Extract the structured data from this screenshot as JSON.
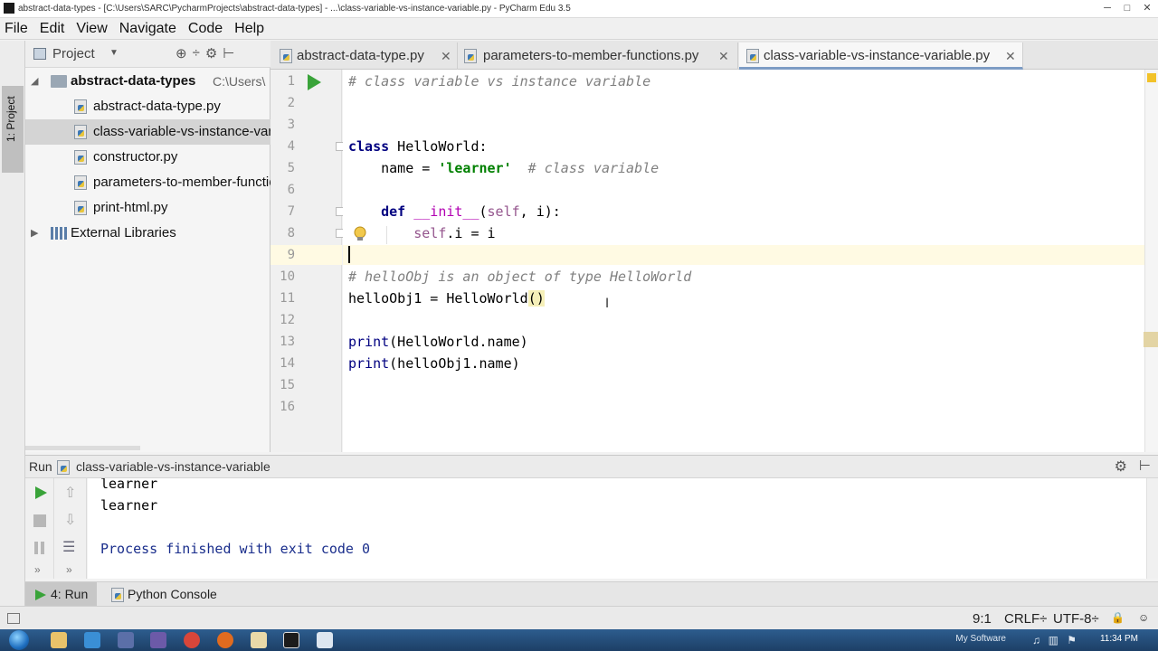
{
  "titlebar": {
    "title": "abstract-data-types - [C:\\Users\\SARC\\PycharmProjects\\abstract-data-types] - ...\\class-variable-vs-instance-variable.py - PyCharm Edu 3.5",
    "minimize": "─",
    "maximize": "□",
    "close": "✕"
  },
  "menu": [
    "File",
    "Edit",
    "View",
    "Navigate",
    "Code",
    "Help"
  ],
  "leftstripe": {
    "project_tab": "1: Project"
  },
  "project_panel": {
    "label": "Project",
    "tools": [
      "⊕",
      "÷",
      "⚙",
      "⊢"
    ],
    "root": {
      "name": "abstract-data-types",
      "path": "C:\\Users\\"
    },
    "files": [
      "abstract-data-type.py",
      "class-variable-vs-instance-variable.py",
      "constructor.py",
      "parameters-to-member-functions.py",
      "print-html.py"
    ],
    "external": "External Libraries"
  },
  "tabs": [
    {
      "label": "abstract-data-type.py",
      "close": "✕"
    },
    {
      "label": "parameters-to-member-functions.py",
      "close": "✕"
    },
    {
      "label": "class-variable-vs-instance-variable.py",
      "close": "✕"
    }
  ],
  "editor": {
    "line_numbers": [
      "1",
      "2",
      "3",
      "4",
      "5",
      "6",
      "7",
      "8",
      "9",
      "10",
      "11",
      "12",
      "13",
      "14",
      "15",
      "16"
    ],
    "code": {
      "l1": "# class variable vs instance variable",
      "l4_kw": "class",
      "l4_rest": " HelloWorld:",
      "l5_a": "    name = ",
      "l5_str": "'learner'",
      "l5_cmt": "  # class variable",
      "l7_indent": "    ",
      "l7_kw": "def",
      "l7_sp": " ",
      "l7_init": "__init__",
      "l7_open": "(",
      "l7_self": "self",
      "l7_rest": ", i):",
      "l8_indent": "        ",
      "l8_self": "self",
      "l8_rest": ".i = i",
      "l10": "# helloObj is an object of type HelloWorld",
      "l11_a": "helloObj1 = HelloWorld",
      "l11_paren": "()",
      "l13_print": "print",
      "l13_rest": "(HelloWorld.name)",
      "l14_print": "print",
      "l14_rest": "(helloObj1.name)"
    },
    "text_cursor": "I"
  },
  "run": {
    "label": "Run",
    "config": "class-variable-vs-instance-variable",
    "gear": "⚙",
    "pin": "⊢",
    "output": [
      "learner",
      "learner",
      "",
      "Process finished with exit code 0"
    ],
    "output_colors": {
      "normal": "#000000",
      "process": "#1a2e8c"
    }
  },
  "bottom_tabs": [
    {
      "label": "4: Run",
      "active": true
    },
    {
      "label": "Python Console",
      "active": false
    }
  ],
  "status": {
    "position": "9:1",
    "line_sep": "CRLF÷",
    "encoding": "UTF-8÷",
    "lock": "🔒"
  },
  "taskbar": {
    "tray_label": "My Software",
    "clock": "11:34 PM"
  },
  "colors": {
    "accent": "#3d79b6",
    "run_green": "#39a339",
    "comment": "#808080",
    "keyword": "#000080",
    "string": "#008000"
  }
}
